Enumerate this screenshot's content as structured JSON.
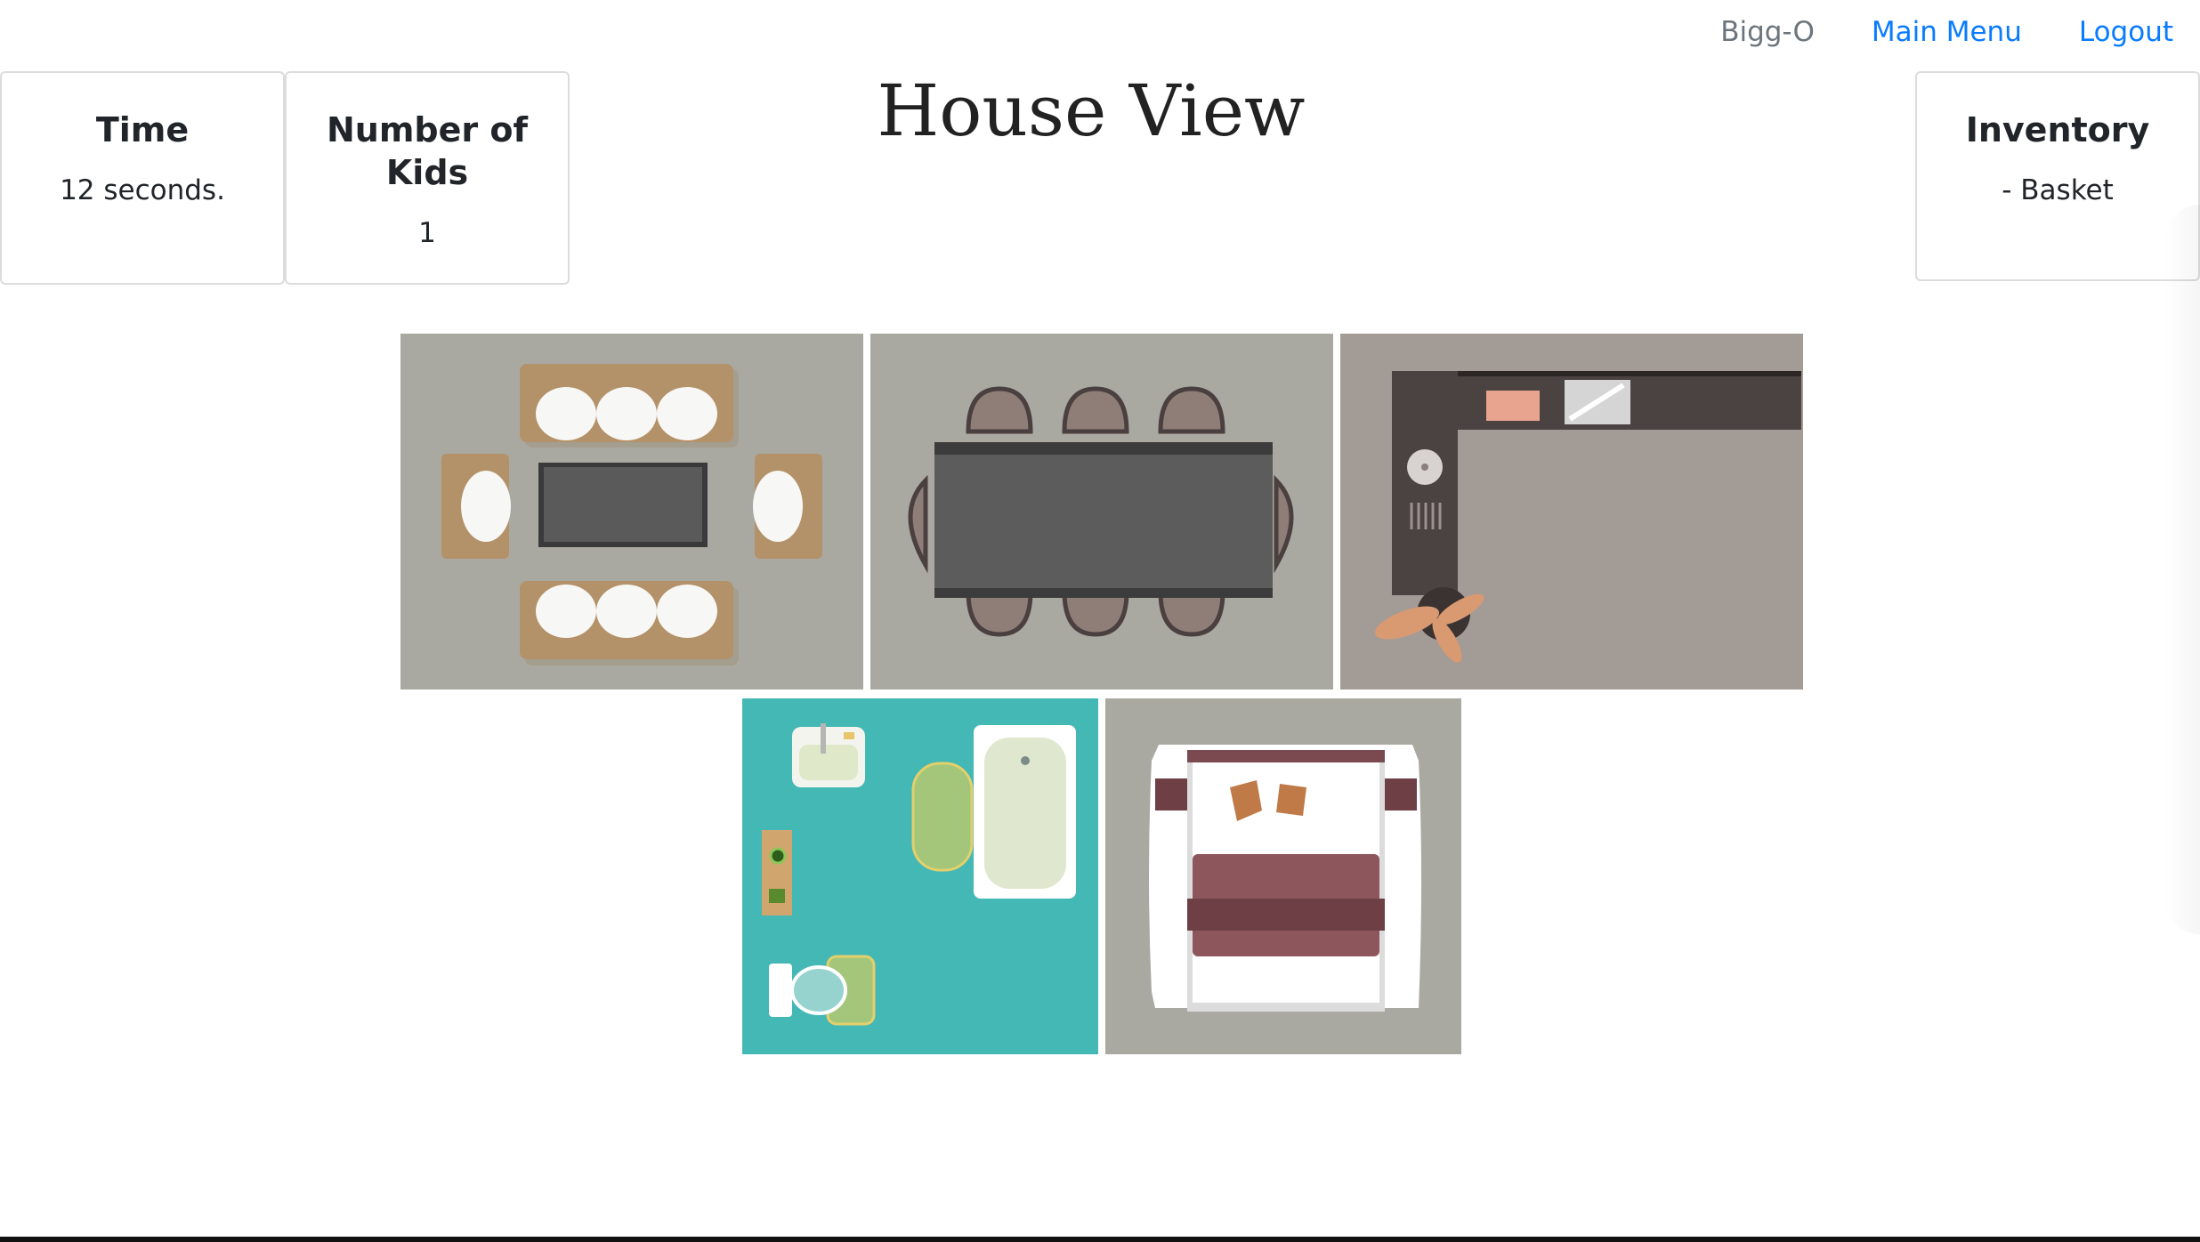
{
  "nav": {
    "username": "Bigg-O",
    "main_menu": "Main Menu",
    "logout": "Logout"
  },
  "page_title": "House View",
  "stats": {
    "time": {
      "label": "Time",
      "value": "12 seconds."
    },
    "kids": {
      "label": "Number of Kids",
      "value": "1"
    },
    "inventory": {
      "label": "Inventory",
      "items": [
        "- Basket"
      ]
    }
  },
  "rooms": [
    {
      "name": "living-room",
      "icon": "living-room-floorplan"
    },
    {
      "name": "dining-room",
      "icon": "dining-room-floorplan"
    },
    {
      "name": "kitchen",
      "icon": "kitchen-floorplan"
    },
    {
      "name": "bathroom",
      "icon": "bathroom-floorplan"
    },
    {
      "name": "bedroom",
      "icon": "bedroom-floorplan"
    }
  ],
  "colors": {
    "link": "#0a7bff",
    "muted": "#6c757d",
    "floor_gray": "#a9a8a0",
    "bathroom_teal": "#43b8b5"
  }
}
